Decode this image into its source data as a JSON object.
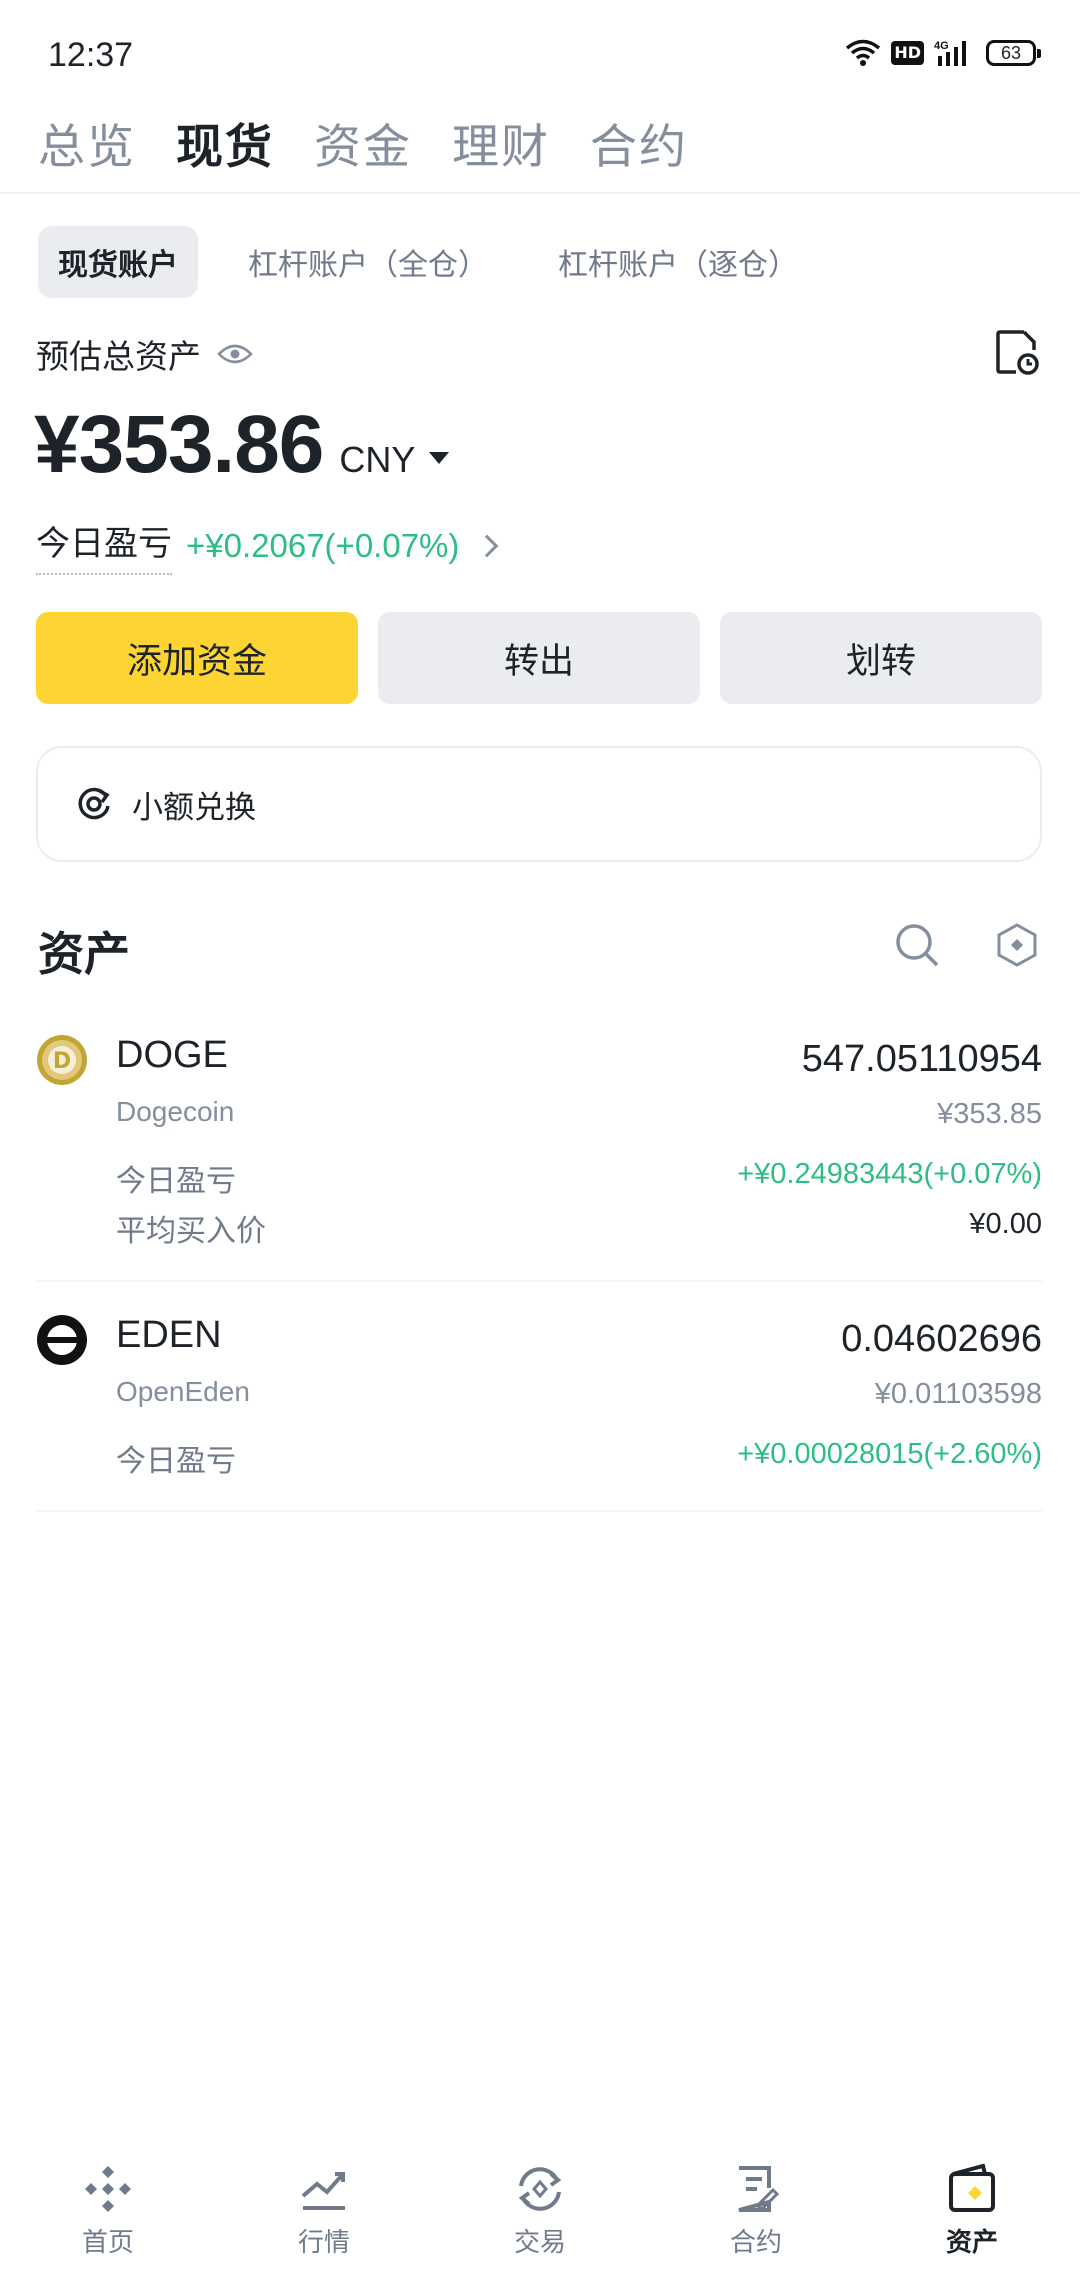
{
  "status_bar": {
    "time": "12:37",
    "network": "4G",
    "hd": "HD",
    "battery": "63"
  },
  "top_tabs": [
    "总览",
    "现货",
    "资金",
    "理财",
    "合约"
  ],
  "active_top_tab": 1,
  "sub_tabs": [
    "现货账户",
    "杠杆账户（全仓）",
    "杠杆账户（逐仓）"
  ],
  "summary": {
    "label": "预估总资产",
    "amount": "¥353.86",
    "currency": "CNY",
    "pnl_label": "今日盈亏",
    "pnl_value": "+¥0.2067(+0.07%)"
  },
  "actions": {
    "add_funds": "添加资金",
    "withdraw": "转出",
    "transfer": "划转"
  },
  "dust": {
    "label": "小额兑换"
  },
  "assets": {
    "title": "资产",
    "items": [
      {
        "symbol": "DOGE",
        "name": "Dogecoin",
        "amount": "547.05110954",
        "value": "¥353.85",
        "pnl_label": "今日盈亏",
        "pnl": "+¥0.24983443(+0.07%)",
        "avg_label": "平均买入价",
        "avg": "¥0.00"
      },
      {
        "symbol": "EDEN",
        "name": "OpenEden",
        "amount": "0.04602696",
        "value": "¥0.01103598",
        "pnl_label": "今日盈亏",
        "pnl": "+¥0.00028015(+2.60%)"
      }
    ]
  },
  "bottom_nav": [
    "首页",
    "行情",
    "交易",
    "合约",
    "资产"
  ],
  "colors": {
    "brand_yellow": "#fcd535",
    "profit_green": "#2ebd85",
    "text_primary": "#1e2329",
    "text_secondary": "#848e9c"
  }
}
